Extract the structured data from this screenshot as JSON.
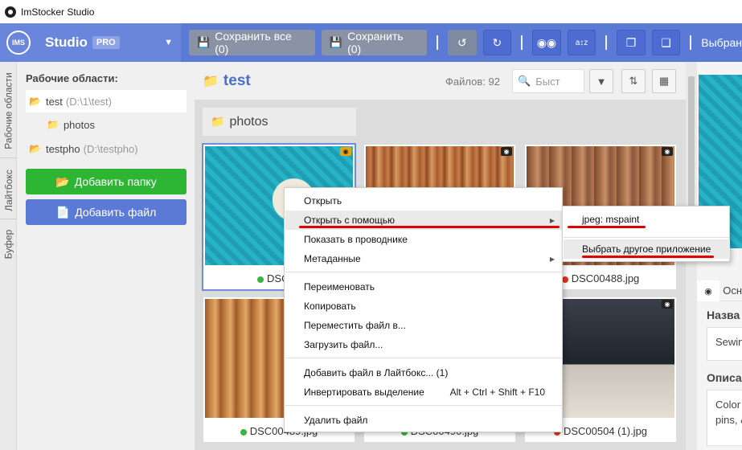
{
  "window": {
    "title": "ImStocker Studio"
  },
  "toolbar": {
    "logo": "IMS",
    "studio": "Studio",
    "pro": "PRO",
    "save_all": "Сохранить все (0)",
    "save": "Сохранить (0)",
    "selected_text": "Выбран"
  },
  "vtabs": [
    "Рабочие области",
    "Лайтбокс",
    "Буфер"
  ],
  "sidebar": {
    "title": "Рабочие области:",
    "workspaces": [
      {
        "name": "test",
        "path": "(D:\\1\\test)"
      },
      {
        "name": "photos",
        "path": ""
      },
      {
        "name": "testpho",
        "path": "(D:\\testpho)"
      }
    ],
    "add_folder": "Добавить папку",
    "add_file": "Добавить файл"
  },
  "main": {
    "title": "test",
    "file_count": "Файлов: 92",
    "search_placeholder": "Быст",
    "folder": "photos",
    "thumbs": [
      {
        "name": "DSC00",
        "status": "green"
      },
      {
        "name": "",
        "status": ""
      },
      {
        "name": "DSC00488.jpg",
        "status": "red"
      },
      {
        "name": "DSC00489.jpg",
        "status": "green"
      },
      {
        "name": "DSC00490.jpg",
        "status": "green"
      },
      {
        "name": "DSC00504 (1).jpg",
        "status": "red"
      }
    ]
  },
  "context_menu": {
    "items": [
      "Открыть",
      "Открыть с помощью",
      "Показать в проводнике",
      "Метаданные",
      "Переименовать",
      "Копировать",
      "Переместить файл в...",
      "Загрузить файл...",
      "Добавить файл в Лайтбокс... (1)",
      "Инвертировать выделение",
      "Удалить файл"
    ],
    "invert_hotkey": "Alt + Ctrl + Shift + F10"
  },
  "submenu": {
    "items": [
      "jpeg: mspaint",
      "Выбрать другое приложение"
    ]
  },
  "right_panel": {
    "tab": "Осн",
    "name_label": "Назва",
    "name_value": "Sewin",
    "desc_label": "Описа",
    "desc_line1": "Color",
    "desc_line2": "pins, &"
  },
  "colors": {
    "accent": "#5b7ad6",
    "green": "#2fb534",
    "red_annotation": "#e00000"
  }
}
